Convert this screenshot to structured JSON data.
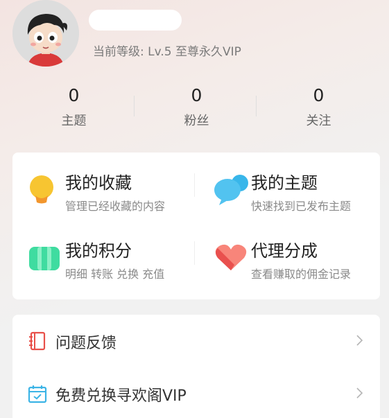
{
  "profile": {
    "level_text": "当前等级: Lv.5 至尊永久VIP",
    "avatar_icon": "cartoon-boy-avatar"
  },
  "stats": [
    {
      "value": "0",
      "label": "主题"
    },
    {
      "value": "0",
      "label": "粉丝"
    },
    {
      "value": "0",
      "label": "关注"
    }
  ],
  "features": [
    {
      "title": "我的收藏",
      "desc": "管理已经收藏的内容",
      "icon": "lightbulb-icon",
      "color": "#f7c531"
    },
    {
      "title": "我的主题",
      "desc": "快速找到已发布主题",
      "icon": "chat-bubble-icon",
      "color": "#38b6ea"
    },
    {
      "title": "我的积分",
      "desc": "明细 转账 兑换 充值",
      "icon": "points-card-icon",
      "color": "#3fdca0"
    },
    {
      "title": "代理分成",
      "desc": "查看赚取的佣金记录",
      "icon": "heart-icon",
      "color": "#f5645f"
    }
  ],
  "menu": [
    {
      "label": "问题反馈",
      "icon": "notebook-icon",
      "color": "#e8504a"
    },
    {
      "label": "免费兑换寻欢阁VIP",
      "icon": "calendar-icon",
      "color": "#3cb4e6"
    }
  ]
}
